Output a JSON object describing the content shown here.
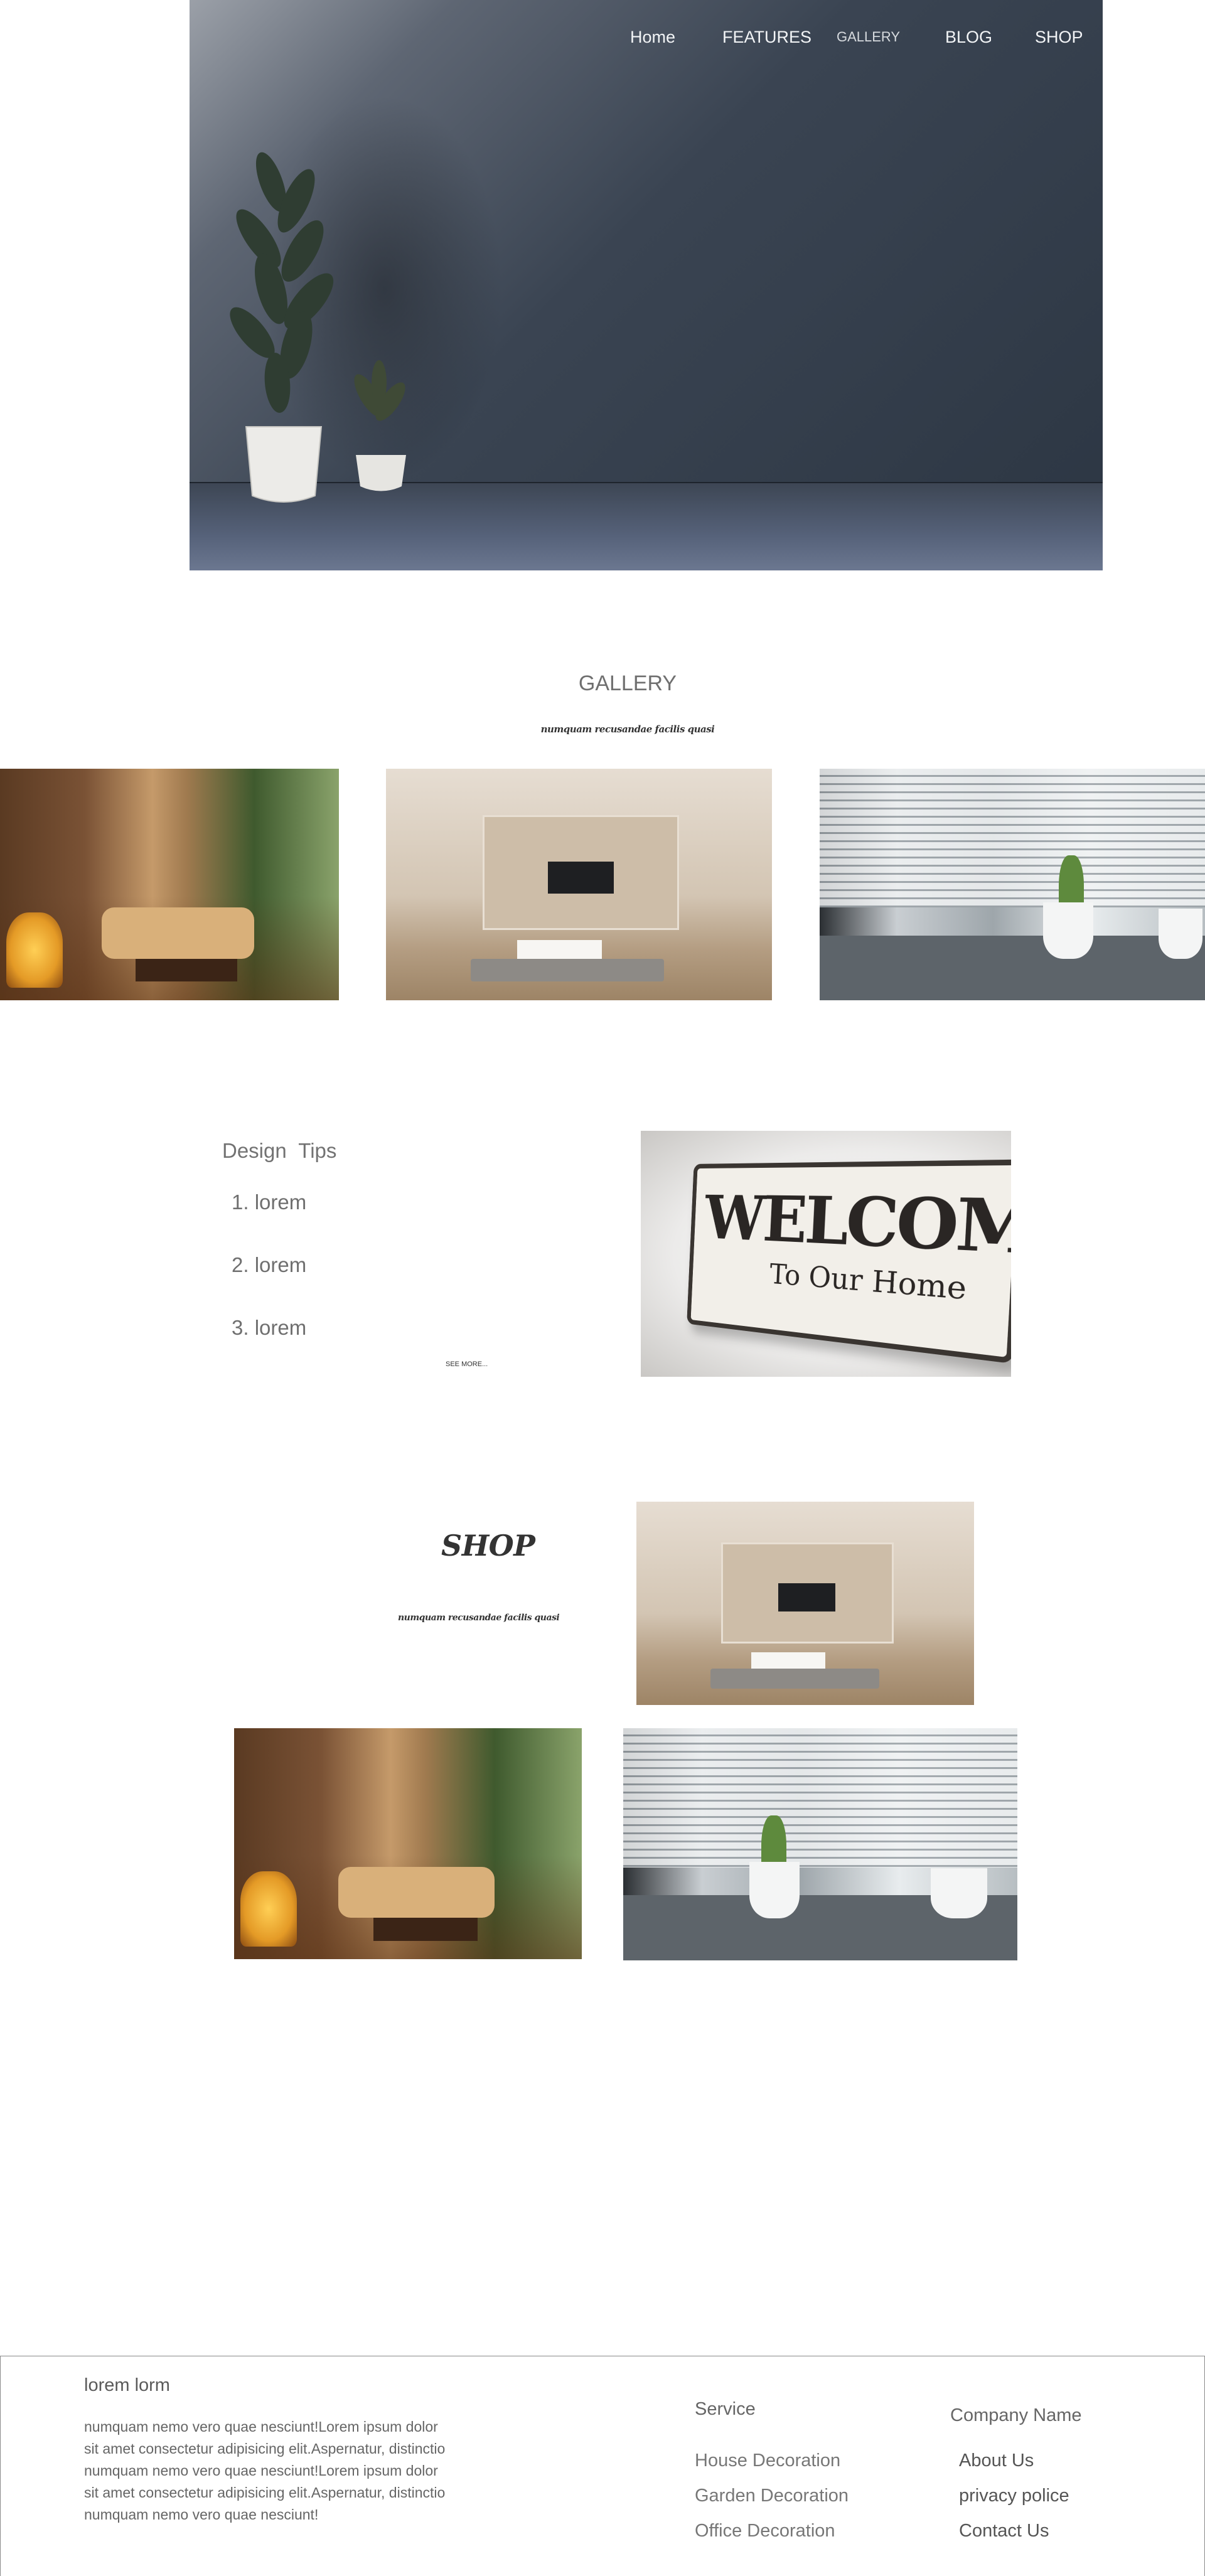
{
  "nav": {
    "home": "Home",
    "features": "FEATURES",
    "gallery": "GALLERY",
    "blog": "BLOG",
    "shop": "SHOP"
  },
  "gallery": {
    "title": "GALLERY",
    "subtitle": "numquam recusandae facilis quasi"
  },
  "design_tips": {
    "title": "Design  Tips",
    "items": [
      "1. lorem",
      "2. lorem",
      "3. lorem"
    ],
    "see_more": "SEE MORE...",
    "sign_line1": "WELCOME",
    "sign_line2": "To Our Home"
  },
  "shop": {
    "title": "SHOP",
    "subtitle": "numquam recusandae facilis quasi"
  },
  "footer": {
    "title": "lorem lorm",
    "body": "numquam nemo vero quae nesciunt!Lorem ipsum dolor sit amet consectetur adipisicing elit.Aspernatur, distinctio numquam nemo vero quae nesciunt!Lorem ipsum dolor sit amet consectetur adipisicing elit.Aspernatur, distinctio numquam nemo vero quae nesciunt!",
    "service_heading": "Service",
    "service_links": [
      "House Decoration",
      "Garden Decoration",
      "Office Decoration"
    ],
    "company_heading": "Company Name",
    "company_links": [
      "About Us",
      "privacy police",
      "Contact Us"
    ]
  },
  "colors": {
    "hero_wall": "#2c3643",
    "text_gray": "#6f6f6f",
    "nav_text": "#f2f4f6"
  }
}
